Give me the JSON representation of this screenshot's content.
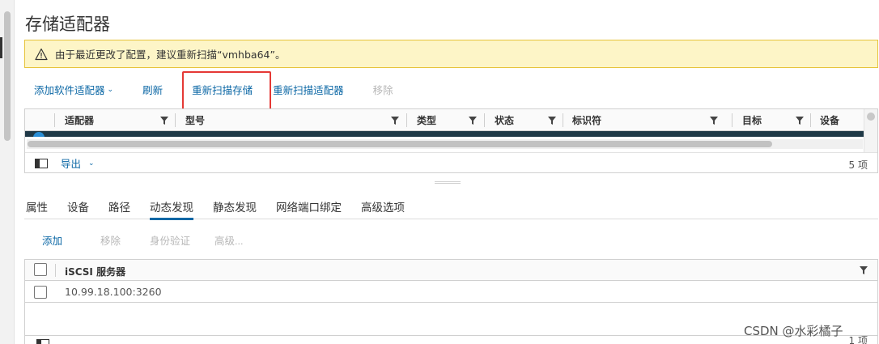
{
  "page": {
    "title": "存储适配器"
  },
  "alert": {
    "text": "由于最近更改了配置，建议重新扫描“vmhba64”。"
  },
  "toolbar": {
    "add_software_adapter": "添加软件适配器",
    "refresh": "刷新",
    "rescan_storage": "重新扫描存储",
    "rescan_adapter": "重新扫描适配器",
    "remove": "移除"
  },
  "adapters_grid": {
    "columns": [
      "适配器",
      "型号",
      "类型",
      "状态",
      "标识符",
      "目标",
      "设备"
    ],
    "footer": {
      "export": "导出",
      "count": "5 项"
    }
  },
  "tabs": [
    "属性",
    "设备",
    "路径",
    "动态发现",
    "静态发现",
    "网络端口绑定",
    "高级选项"
  ],
  "active_tab": "动态发现",
  "discovery_toolbar": {
    "add": "添加",
    "remove": "移除",
    "authentication": "身份验证",
    "advanced": "高级..."
  },
  "iscsi_grid": {
    "header": "iSCSI 服务器",
    "rows": [
      "10.99.18.100:3260"
    ],
    "count": "1 项"
  },
  "watermark": "CSDN @水彩橘子",
  "colors": {
    "accent": "#0b67a5",
    "alert_bg": "#fdf5c7",
    "highlight": "#e53935",
    "selected_row": "#1f3947"
  }
}
